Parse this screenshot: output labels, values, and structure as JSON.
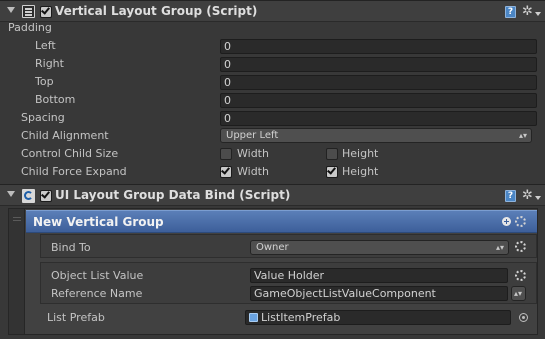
{
  "vertical_layout_group": {
    "title": "Vertical Layout Group (Script)",
    "padding": {
      "label": "Padding",
      "left": {
        "label": "Left",
        "value": "0"
      },
      "right": {
        "label": "Right",
        "value": "0"
      },
      "top": {
        "label": "Top",
        "value": "0"
      },
      "bottom": {
        "label": "Bottom",
        "value": "0"
      }
    },
    "spacing": {
      "label": "Spacing",
      "value": "0"
    },
    "child_alignment": {
      "label": "Child Alignment",
      "value": "Upper Left"
    },
    "control_child_size": {
      "label": "Control Child Size",
      "width": {
        "label": "Width",
        "checked": false
      },
      "height": {
        "label": "Height",
        "checked": false
      }
    },
    "child_force_expand": {
      "label": "Child Force Expand",
      "width": {
        "label": "Width",
        "checked": true
      },
      "height": {
        "label": "Height",
        "checked": true
      }
    }
  },
  "ui_layout_group_data_bind": {
    "title": "UI Layout Group Data Bind (Script)",
    "element": {
      "title": "New Vertical Group",
      "bind_to": {
        "label": "Bind To",
        "value": "Owner"
      },
      "object_list_value": {
        "label": "Object List Value",
        "value": "Value Holder"
      },
      "reference_name": {
        "label": "Reference Name",
        "value": "GameObjectListValueComponent"
      }
    },
    "list_prefab": {
      "label": "List Prefab",
      "value": "ListItemPrefab"
    }
  },
  "icons": {
    "help": "?",
    "gear": "✲",
    "popup_arrows": "▴▾"
  },
  "colors": {
    "background": "#383838",
    "header": "#3f3f3f",
    "selected_element": "#4a6da8",
    "help_icon": "#4b86c5"
  }
}
